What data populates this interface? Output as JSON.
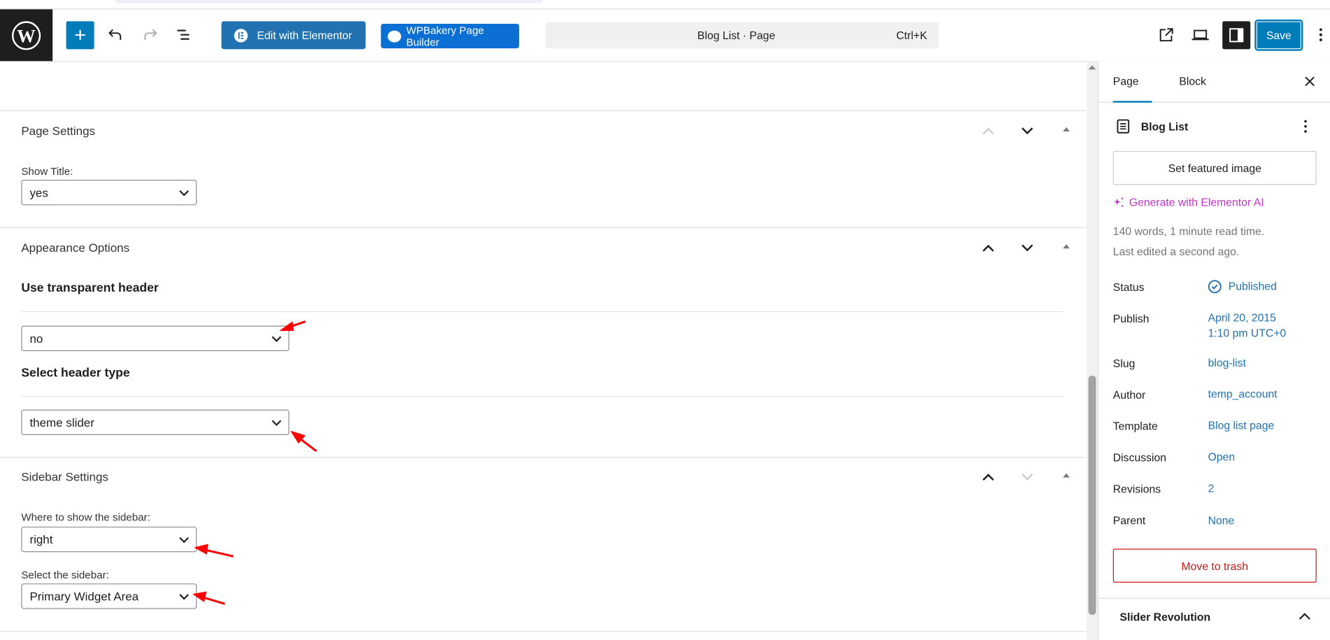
{
  "toolbar": {
    "elementor_label": "Edit with Elementor",
    "wpbakery_label": "WPBakery Page Builder",
    "command_title": "Blog List · Page",
    "command_shortcut": "Ctrl+K",
    "save_label": "Save"
  },
  "main": {
    "page_settings": {
      "title": "Page Settings",
      "show_title_label": "Show Title:",
      "show_title_value": "yes"
    },
    "appearance": {
      "title": "Appearance Options",
      "transparent_label": "Use transparent header",
      "transparent_value": "no",
      "header_type_label": "Select header type",
      "header_type_value": "theme slider"
    },
    "sidebar_settings": {
      "title": "Sidebar Settings",
      "where_label": "Where to show the sidebar:",
      "where_value": "right",
      "select_label": "Select the sidebar:",
      "select_value": "Primary Widget Area"
    }
  },
  "sidebar": {
    "tabs": [
      "Page",
      "Block"
    ],
    "post_title": "Blog List",
    "featured_image_label": "Set featured image",
    "ai_label": "Generate with Elementor AI",
    "stats": "140 words, 1 minute read time.",
    "last_edited": "Last edited a second ago.",
    "rows": [
      {
        "label": "Status",
        "value": "Published"
      },
      {
        "label": "Publish",
        "value": "April 20, 2015",
        "value2": "1:10 pm UTC+0"
      },
      {
        "label": "Slug",
        "value": "blog-list"
      },
      {
        "label": "Author",
        "value": "temp_account"
      },
      {
        "label": "Template",
        "value": "Blog list page"
      },
      {
        "label": "Discussion",
        "value": "Open"
      },
      {
        "label": "Revisions",
        "value": "2"
      },
      {
        "label": "Parent",
        "value": "None"
      }
    ],
    "trash_label": "Move to trash",
    "slider_revolution": "Slider Revolution"
  },
  "colors": {
    "accent": "#007cba",
    "link": "#2271b1",
    "ai": "#c036c7",
    "danger": "#cc1818",
    "annotation": "#ff0000"
  }
}
